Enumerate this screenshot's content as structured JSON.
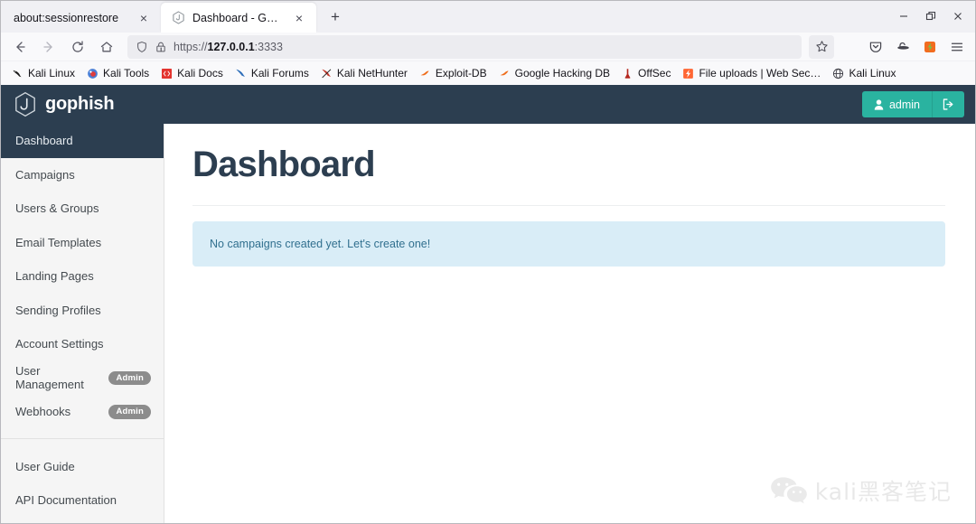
{
  "browser": {
    "tabs": [
      {
        "title": "about:sessionrestore",
        "favicon": "none",
        "active": false,
        "close_label": "×"
      },
      {
        "title": "Dashboard - Gophish",
        "favicon": "gophish-hexagon-icon",
        "active": true,
        "close_label": "×"
      }
    ],
    "new_tab_label": "+",
    "window_controls": {
      "minimize": "minimize-icon",
      "restore": "restore-icon",
      "close": "close-icon"
    },
    "toolbar": {
      "back": "back-arrow-icon",
      "forward": "forward-arrow-icon",
      "reload": "reload-icon",
      "home": "home-icon",
      "shield": "shield-icon",
      "lock_warning": "lock-warning-icon",
      "url_scheme": "https://",
      "url_host": "127.0.0.1",
      "url_port": ":3333",
      "url_full": "https://127.0.0.1:3333",
      "bookmark_star": "star-icon",
      "pocket": "pocket-icon",
      "container": "hat-icon",
      "extension": "extension-icon",
      "menu": "hamburger-menu-icon"
    },
    "bookmarks": [
      {
        "label": "Kali Linux",
        "icon": "kali-dragon-icon"
      },
      {
        "label": "Kali Tools",
        "icon": "kali-tools-icon"
      },
      {
        "label": "Kali Docs",
        "icon": "kali-docs-icon"
      },
      {
        "label": "Kali Forums",
        "icon": "kali-forums-icon"
      },
      {
        "label": "Kali NetHunter",
        "icon": "kali-nethunter-icon"
      },
      {
        "label": "Exploit-DB",
        "icon": "exploitdb-icon"
      },
      {
        "label": "Google Hacking DB",
        "icon": "ghdb-icon"
      },
      {
        "label": "OffSec",
        "icon": "offsec-icon"
      },
      {
        "label": "File uploads | Web Sec…",
        "icon": "portswigger-icon"
      },
      {
        "label": "Kali Linux",
        "icon": "globe-icon"
      }
    ]
  },
  "app": {
    "brand": {
      "name": "gophish",
      "logo": "gophish-hexagon-icon"
    },
    "user": {
      "name": "admin",
      "user_icon": "user-icon",
      "logout_icon": "sign-out-icon"
    },
    "sidebar": {
      "items": [
        {
          "label": "Dashboard",
          "active": true,
          "badge": ""
        },
        {
          "label": "Campaigns",
          "active": false,
          "badge": ""
        },
        {
          "label": "Users & Groups",
          "active": false,
          "badge": ""
        },
        {
          "label": "Email Templates",
          "active": false,
          "badge": ""
        },
        {
          "label": "Landing Pages",
          "active": false,
          "badge": ""
        },
        {
          "label": "Sending Profiles",
          "active": false,
          "badge": ""
        },
        {
          "label": "Account Settings",
          "active": false,
          "badge": ""
        },
        {
          "label": "User Management",
          "active": false,
          "badge": "Admin"
        },
        {
          "label": "Webhooks",
          "active": false,
          "badge": "Admin"
        }
      ],
      "footer_items": [
        {
          "label": "User Guide"
        },
        {
          "label": "API Documentation"
        }
      ]
    },
    "main": {
      "page_title": "Dashboard",
      "alert_text": "No campaigns created yet. Let's create one!"
    },
    "watermark": {
      "icon": "wechat-icon",
      "text": "kali黑客笔记"
    }
  },
  "colors": {
    "navbar": "#2c3e50",
    "accent_teal": "#2ab3a0",
    "alert_bg": "#d9edf7",
    "alert_text": "#31708f",
    "sidebar_bg": "#f5f5f5",
    "badge_gray": "#8c8c8c"
  }
}
